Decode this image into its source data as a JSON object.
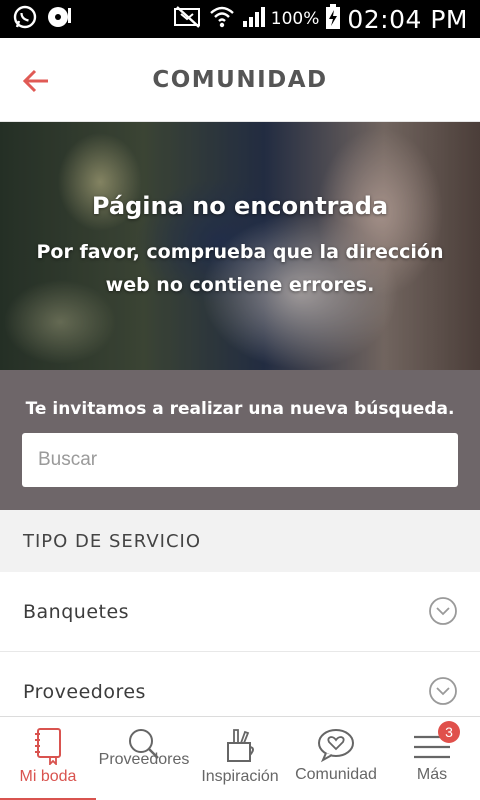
{
  "status_bar": {
    "battery_percent": "100%",
    "time": "02:04 PM",
    "icons": [
      "whatsapp-icon",
      "music-disc-icon",
      "nfc-muted-icon",
      "wifi-icon",
      "signal-icon",
      "battery-charging-icon"
    ]
  },
  "header": {
    "title": "COMUNIDAD",
    "back_icon": "arrow-left-icon"
  },
  "hero": {
    "title": "Página no encontrada",
    "subtitle": "Por favor, comprueba que la dirección web no contiene errores."
  },
  "search": {
    "invite": "Te invitamos a realizar una nueva búsqueda.",
    "placeholder": "Buscar",
    "value": ""
  },
  "service_section": {
    "header": "TIPO DE SERVICIO",
    "items": [
      {
        "label": "Banquetes",
        "icon": "chevron-down-icon"
      },
      {
        "label": "Proveedores",
        "icon": "chevron-down-icon"
      }
    ]
  },
  "bottom_nav": {
    "items": [
      {
        "label": "Mi boda",
        "icon": "notebook-icon",
        "active": true
      },
      {
        "label": "Proveedores",
        "icon": "search-icon"
      },
      {
        "label": "Inspiración",
        "icon": "pencil-cup-icon"
      },
      {
        "label": "Comunidad",
        "icon": "chat-heart-icon"
      },
      {
        "label": "Más",
        "icon": "menu-icon",
        "badge": "3"
      }
    ]
  },
  "colors": {
    "accent": "#d9534f",
    "search_band": "#6e6669",
    "section_header_bg": "#f2f2f2"
  }
}
